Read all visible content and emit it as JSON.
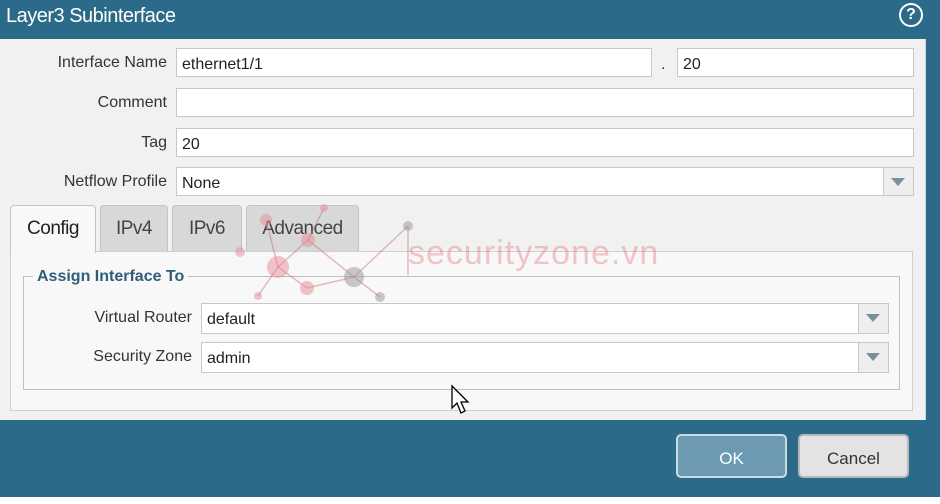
{
  "dialog": {
    "title": "Layer3 Subinterface",
    "help_icon": "?"
  },
  "form": {
    "interface_name_label": "Interface Name",
    "interface_name_value": "ethernet1/1",
    "separator": ".",
    "subinterface_id": "20",
    "comment_label": "Comment",
    "comment_value": "",
    "tag_label": "Tag",
    "tag_value": "20",
    "netflow_label": "Netflow Profile",
    "netflow_value": "None"
  },
  "tabs": [
    {
      "label": "Config",
      "active": true
    },
    {
      "label": "IPv4",
      "active": false
    },
    {
      "label": "IPv6",
      "active": false
    },
    {
      "label": "Advanced",
      "active": false
    }
  ],
  "assign": {
    "legend": "Assign Interface To",
    "virtual_router_label": "Virtual Router",
    "virtual_router_value": "default",
    "security_zone_label": "Security Zone",
    "security_zone_value": "admin"
  },
  "buttons": {
    "ok": "OK",
    "cancel": "Cancel"
  },
  "watermark": "securityzone.vn",
  "colors": {
    "titlebar": "#2c6a8a",
    "ok_button": "#6c9ab3",
    "legend_text": "#2e5f7a"
  }
}
